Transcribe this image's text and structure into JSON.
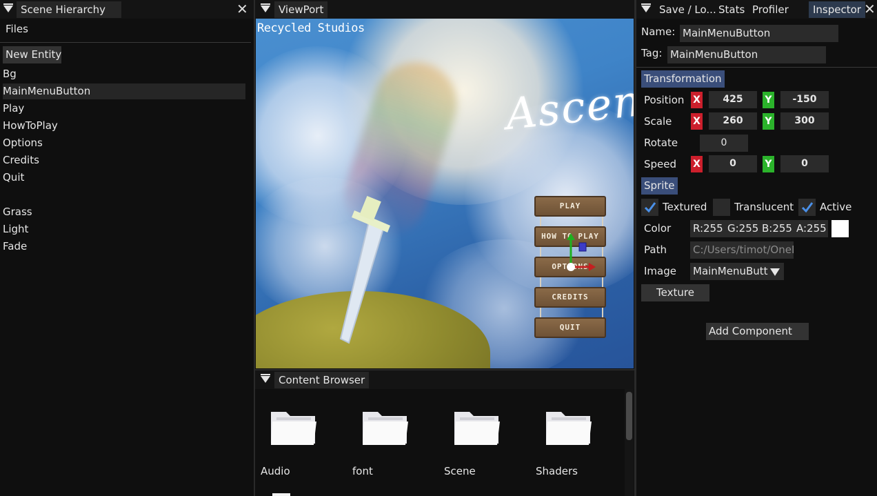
{
  "scene_hierarchy": {
    "title": "Scene Hierarchy",
    "menu_files": "Files",
    "new_entity_label": "New Entity",
    "entities": [
      "Bg",
      "MainMenuButton",
      "Play",
      "HowToPlay",
      "Options",
      "Credits",
      "Quit",
      "",
      "Grass",
      "Light",
      "Fade"
    ],
    "selected": "MainMenuButton"
  },
  "viewport": {
    "title": "ViewPort",
    "studio_text": "Recycled Studios",
    "game_title": "Ascend",
    "menu_buttons": [
      "PLAY",
      "HOW TO PLAY",
      "OPTIONS",
      "CREDITS",
      "QUIT"
    ]
  },
  "content_browser": {
    "title": "Content Browser",
    "folders": [
      "Audio",
      "font",
      "Scene",
      "Shaders"
    ]
  },
  "right_panel": {
    "tabs": [
      "Save / Lo...",
      "Stats",
      "Profiler",
      "Inspector"
    ],
    "active_tab": "Inspector"
  },
  "inspector": {
    "name_label": "Name:",
    "name_value": "MainMenuButton",
    "tag_label": "Tag:",
    "tag_value": "MainMenuButton",
    "transformation_header": "Transformation",
    "axis_x": "X",
    "axis_y": "Y",
    "position_label": "Position",
    "position_x": "425",
    "position_y": "-150",
    "scale_label": "Scale",
    "scale_x": "260",
    "scale_y": "300",
    "rotate_label": "Rotate",
    "rotate_value": "0",
    "speed_label": "Speed",
    "speed_x": "0",
    "speed_y": "0",
    "sprite_header": "Sprite",
    "textured_label": "Textured",
    "translucent_label": "Translucent",
    "active_label": "Active",
    "color_label": "Color",
    "color_r": "R:255",
    "color_g": "G:255",
    "color_b": "B:255",
    "color_a": "A:255",
    "path_label": "Path",
    "path_value": "C:/Users/timot/OneD",
    "image_label": "Image",
    "image_value": "MainMenuButt",
    "texture_button": "Texture",
    "add_component_button": "Add Component"
  },
  "colors": {
    "x_badge": "#cc1f2c",
    "y_badge": "#2bb32b",
    "section_header": "#3a4e7a",
    "active_tab": "#2d3a4e"
  }
}
